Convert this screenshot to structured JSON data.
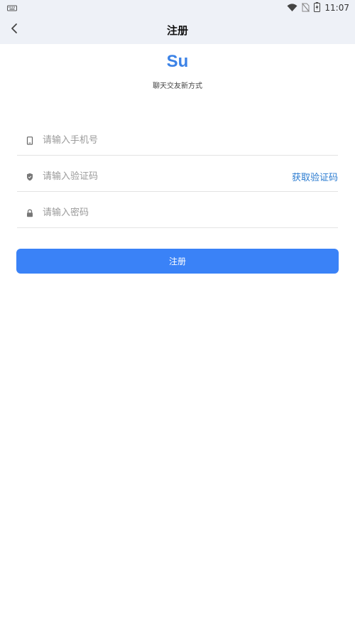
{
  "status_bar": {
    "time": "11:07",
    "icons": [
      "keyboard-icon",
      "wifi-icon",
      "no-sim-icon",
      "battery-charging-icon"
    ]
  },
  "app_bar": {
    "title": "注册",
    "back_icon": "chevron-left-icon"
  },
  "brand": {
    "logo_text": "Su",
    "slogan": "聊天交友新方式",
    "accent_color": "#3b82e6"
  },
  "form": {
    "phone": {
      "placeholder": "请输入手机号",
      "value": "",
      "icon": "phone-icon"
    },
    "code": {
      "placeholder": "请输入验证码",
      "value": "",
      "icon": "shield-icon",
      "action_label": "获取验证码"
    },
    "password": {
      "placeholder": "请输入密码",
      "value": "",
      "icon": "lock-icon"
    }
  },
  "submit": {
    "label": "注册",
    "color": "#3a82f7"
  }
}
